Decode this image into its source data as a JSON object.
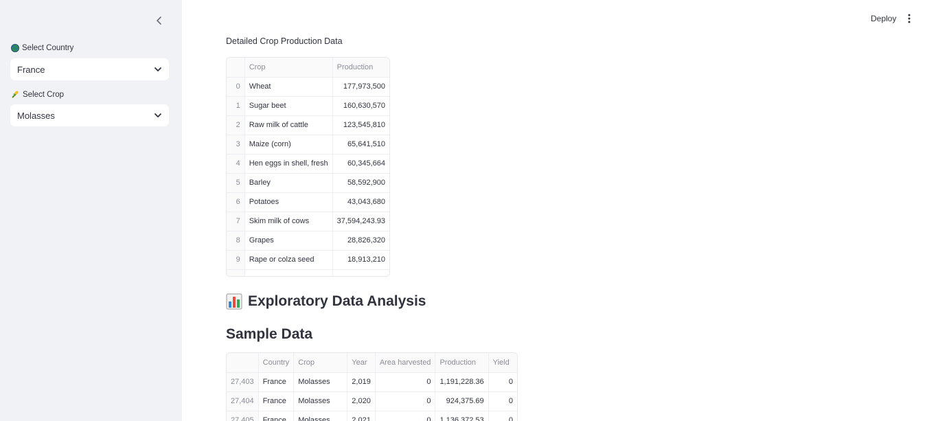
{
  "sidebar": {
    "country_label": "Select Country",
    "country_value": "France",
    "crop_label": "Select Crop",
    "crop_value": "Molasses"
  },
  "header": {
    "deploy_label": "Deploy"
  },
  "crop_table": {
    "caption": "Detailed Crop Production Data",
    "columns": [
      "",
      "Crop",
      "Production"
    ],
    "rows": [
      {
        "idx": "0",
        "crop": "Wheat",
        "production": "177,973,500"
      },
      {
        "idx": "1",
        "crop": "Sugar beet",
        "production": "160,630,570"
      },
      {
        "idx": "2",
        "crop": "Raw milk of cattle",
        "production": "123,545,810"
      },
      {
        "idx": "3",
        "crop": "Maize (corn)",
        "production": "65,641,510"
      },
      {
        "idx": "4",
        "crop": "Hen eggs in shell, fresh",
        "production": "60,345,664"
      },
      {
        "idx": "5",
        "crop": "Barley",
        "production": "58,592,900"
      },
      {
        "idx": "6",
        "crop": "Potatoes",
        "production": "43,043,680"
      },
      {
        "idx": "7",
        "crop": "Skim milk of cows",
        "production": "37,594,243.93"
      },
      {
        "idx": "8",
        "crop": "Grapes",
        "production": "28,826,320"
      },
      {
        "idx": "9",
        "crop": "Rape or colza seed",
        "production": "18,913,210"
      }
    ]
  },
  "eda_heading": "Exploratory Data Analysis",
  "sample_heading": "Sample Data",
  "sample_table": {
    "columns": [
      "",
      "Country",
      "Crop",
      "Year",
      "Area harvested",
      "Production",
      "Yield"
    ],
    "rows": [
      {
        "idx": "27,403",
        "country": "France",
        "crop": "Molasses",
        "year": "2,019",
        "area": "0",
        "production": "1,191,228.36",
        "yield": "0"
      },
      {
        "idx": "27,404",
        "country": "France",
        "crop": "Molasses",
        "year": "2,020",
        "area": "0",
        "production": "924,375.69",
        "yield": "0"
      },
      {
        "idx": "27,405",
        "country": "France",
        "crop": "Molasses",
        "year": "2,021",
        "area": "0",
        "production": "1,136,372.53",
        "yield": "0"
      }
    ]
  }
}
